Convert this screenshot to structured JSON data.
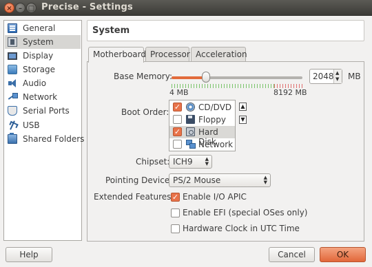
{
  "window": {
    "title": "Precise - Settings"
  },
  "sidebar": {
    "items": [
      {
        "label": "General",
        "icon": "general-icon"
      },
      {
        "label": "System",
        "icon": "system-icon",
        "selected": true
      },
      {
        "label": "Display",
        "icon": "display-icon"
      },
      {
        "label": "Storage",
        "icon": "storage-icon"
      },
      {
        "label": "Audio",
        "icon": "audio-icon"
      },
      {
        "label": "Network",
        "icon": "network-icon"
      },
      {
        "label": "Serial Ports",
        "icon": "serial-ports-icon"
      },
      {
        "label": "USB",
        "icon": "usb-icon"
      },
      {
        "label": "Shared Folders",
        "icon": "shared-folders-icon"
      }
    ]
  },
  "header": {
    "title": "System"
  },
  "tabs": [
    {
      "label": "Motherboard",
      "active": true
    },
    {
      "label": "Processor"
    },
    {
      "label": "Acceleration"
    }
  ],
  "motherboard": {
    "base_memory": {
      "label": "Base Memory:",
      "value": "2048",
      "unit": "MB",
      "min_label": "4 MB",
      "max_label": "8192 MB",
      "fraction": 0.25
    },
    "boot_order": {
      "label": "Boot Order:",
      "items": [
        {
          "label": "CD/DVD",
          "checked": true,
          "icon": "cd-dvd-icon"
        },
        {
          "label": "Floppy",
          "checked": false,
          "icon": "floppy-icon"
        },
        {
          "label": "Hard Disk",
          "checked": true,
          "icon": "hard-disk-icon",
          "selected": true
        },
        {
          "label": "Network",
          "checked": false,
          "icon": "network-boot-icon"
        }
      ]
    },
    "chipset": {
      "label": "Chipset:",
      "value": "ICH9"
    },
    "pointing_device": {
      "label": "Pointing Device:",
      "value": "PS/2 Mouse"
    },
    "extended_features": {
      "label": "Extended Features:",
      "items": [
        {
          "label": "Enable I/O APIC",
          "checked": true
        },
        {
          "label": "Enable EFI (special OSes only)",
          "checked": false
        },
        {
          "label": "Hardware Clock in UTC Time",
          "checked": false
        }
      ]
    }
  },
  "buttons": {
    "help": "Help",
    "cancel": "Cancel",
    "ok": "OK"
  },
  "colors": {
    "accent": "#e8734a",
    "titlebar": "#3c3b37"
  }
}
